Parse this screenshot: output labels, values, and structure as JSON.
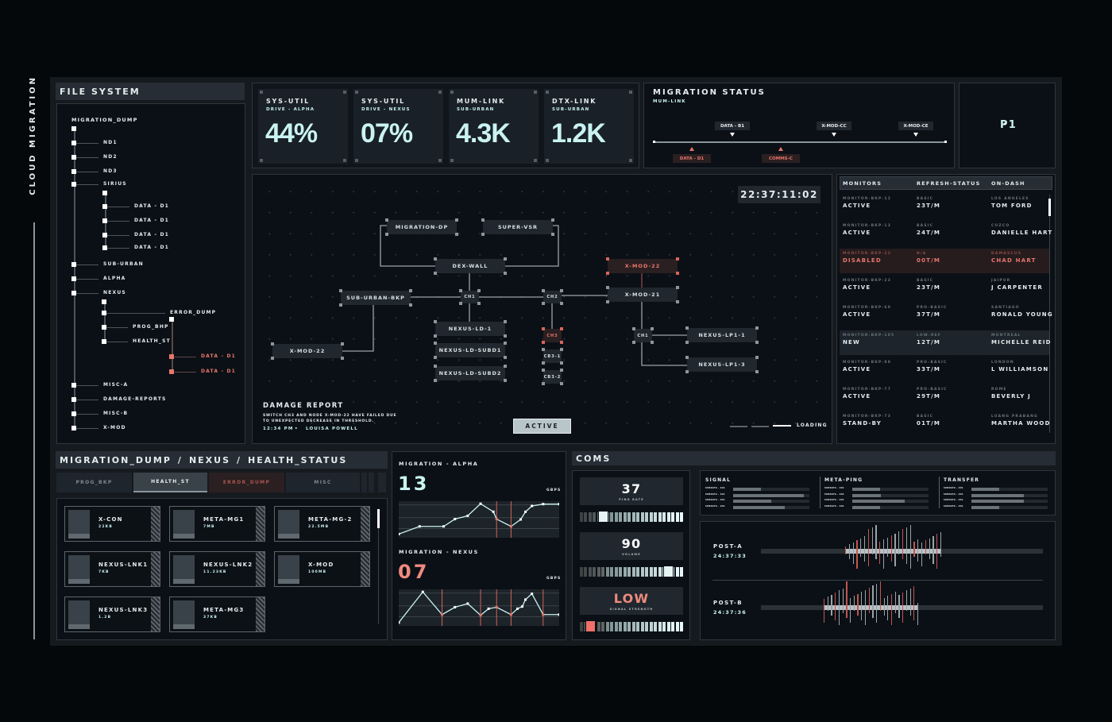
{
  "side_title": "CLOUD MIGRATION",
  "file_system": {
    "title": "FILE SYSTEM",
    "root": "MIGRATION_DUMP",
    "items": [
      {
        "label": "ND1"
      },
      {
        "label": "ND2"
      },
      {
        "label": "ND3"
      },
      {
        "label": "SIRIUS"
      },
      {
        "label": "DATA - D1"
      },
      {
        "label": "DATA - D1"
      },
      {
        "label": "DATA - D1"
      },
      {
        "label": "DATA - D1"
      },
      {
        "label": "SUB-URBAN"
      },
      {
        "label": "ALPHA"
      },
      {
        "label": "NEXUS"
      },
      {
        "label": "ERROR_DUMP"
      },
      {
        "label": "PROG_BHP"
      },
      {
        "label": "HEALTH_ST"
      },
      {
        "label": "DATA - D1",
        "state": "error"
      },
      {
        "label": "DATA - D1",
        "state": "error"
      },
      {
        "label": "MISC-A"
      },
      {
        "label": "DAMAGE-REPORTS"
      },
      {
        "label": "MISC-B"
      },
      {
        "label": "X-MOD"
      }
    ]
  },
  "stats": [
    {
      "title": "SYS-UTIL",
      "sub": "DRIVE - ALPHA",
      "value": "44%"
    },
    {
      "title": "SYS-UTIL",
      "sub": "DRIVE - NEXUS",
      "value": "07%"
    },
    {
      "title": "MUM-LINK",
      "sub": "SUB-URBAN",
      "value": "4.3K"
    },
    {
      "title": "DTX-LINK",
      "sub": "SUB-URBAN",
      "value": "1.2K"
    }
  ],
  "migration_status": {
    "title": "MIGRATION STATUS",
    "sub": "MUM-LINK",
    "above": [
      "DATA - B1",
      "X-MOD-CC",
      "X-MOD-CE"
    ],
    "below": [
      "DATA - D1",
      "COMMS-C"
    ]
  },
  "page_marker": "P1",
  "network": {
    "clock": "22:37:11:02",
    "nodes": [
      "MIGRATION-DP",
      "SUPER-VSR",
      "DEX-WALL",
      "X-MOD-22",
      "SUB-URBAN-BKP",
      "CH1",
      "CH2",
      "X-MOD-21",
      "NEXUS-LD-1",
      "NEXUS-LD-SUBD1",
      "NEXUS-LD-SUBD2",
      "CH3",
      "CB3-1",
      "CB3-2",
      "CH1",
      "NEXUS-LP1-1",
      "NEXUS-LP1-3",
      "X-MOD-22"
    ],
    "failed": [
      3,
      11
    ],
    "damage_title": "DAMAGE REPORT",
    "damage_text": "SWITCH CH3 AND NODE X-MOD-22 HAVE FAILED DUE TO UNEXPECTED DECREASE IN THRESHOLD.",
    "damage_time": "12:34 PM",
    "damage_author": "LOUISA POWELL",
    "status_button": "ACTIVE",
    "loading": "LOADING"
  },
  "monitors": {
    "headers": [
      "MONITORS",
      "REFRESH-STATUS",
      "ON-DASH"
    ],
    "rows": [
      {
        "id": "MONITOR-BKP-12",
        "status": "ACTIVE",
        "plan": "BASIC",
        "rate": "23T/M",
        "city": "LOS ANGELES",
        "name": "TOM FORD"
      },
      {
        "id": "MONITOR-BKP-13",
        "status": "ACTIVE",
        "plan": "BASIC",
        "rate": "24T/M",
        "city": "CUZCO",
        "name": "DANIELLE HART"
      },
      {
        "id": "MONITOR-BKP-22",
        "status": "DISABLED",
        "plan": "N/A",
        "rate": "00T/M",
        "city": "DAMASCUS",
        "name": "CHAD HART",
        "state": "error"
      },
      {
        "id": "MONITOR-BKP-23",
        "status": "ACTIVE",
        "plan": "BASIC",
        "rate": "23T/M",
        "city": "JAIPUR",
        "name": "J CARPENTER"
      },
      {
        "id": "MONITOR-BKP-60",
        "status": "ACTIVE",
        "plan": "PRO-BASIC",
        "rate": "37T/M",
        "city": "SANTIAGO",
        "name": "RONALD YOUNG"
      },
      {
        "id": "MONITOR-BKP-105",
        "status": "NEW",
        "plan": "LOW-REF",
        "rate": "12T/M",
        "city": "MONTREAL",
        "name": "MICHELLE REID",
        "state": "selected"
      },
      {
        "id": "MONITOR-BKP-88",
        "status": "ACTIVE",
        "plan": "PRO-BASIC",
        "rate": "33T/M",
        "city": "LONDON",
        "name": "L WILLIAMSON"
      },
      {
        "id": "MONITOR-BKP-77",
        "status": "ACTIVE",
        "plan": "PRO-BASIC",
        "rate": "29T/M",
        "city": "ROME",
        "name": "BEVERLY J"
      },
      {
        "id": "MONITOR-BKP-73",
        "status": "STAND-BY",
        "plan": "BASIC",
        "rate": "01T/M",
        "city": "LUANG PRABANG",
        "name": "MARTHA WOOD"
      }
    ]
  },
  "breadcrumb": [
    "MIGRATION_DUMP",
    "NEXUS",
    "HEALTH_STATUS"
  ],
  "tabs": [
    {
      "label": "PROG_BKP"
    },
    {
      "label": "HEALTH_ST",
      "active": true
    },
    {
      "label": "ERROR_DUMP",
      "state": "error"
    },
    {
      "label": "MISC"
    }
  ],
  "files": [
    {
      "name": "X-CON",
      "size": "22KB"
    },
    {
      "name": "META-MG1",
      "size": "7MB"
    },
    {
      "name": "META-MG-2",
      "size": "22.5MB"
    },
    {
      "name": "NEXUS-LNK1",
      "size": "7KB"
    },
    {
      "name": "NEXUS-LNK2",
      "size": "11.23KB"
    },
    {
      "name": "X-MOD",
      "size": "100MB"
    },
    {
      "name": "NEXUS-LNK3",
      "size": "1.2B"
    },
    {
      "name": "META-MG3",
      "size": "37KB"
    }
  ],
  "chart_data": [
    {
      "type": "line",
      "title": "MIGRATION - ALPHA",
      "value": "13",
      "unit": "GBPS",
      "x": [
        0,
        13,
        28,
        35,
        43,
        51,
        59,
        61,
        70,
        76,
        79,
        83,
        90,
        100
      ],
      "y": [
        10,
        31,
        31,
        51,
        60,
        93,
        71,
        51,
        31,
        50,
        71,
        87,
        92,
        92
      ],
      "alerts": [
        61,
        70
      ]
    },
    {
      "type": "line",
      "title": "MIGRATION - NEXUS",
      "value": "07",
      "unit": "GBPS",
      "x": [
        0,
        15,
        27,
        35,
        43,
        51,
        56,
        61,
        70,
        74,
        77,
        79,
        83,
        90,
        100
      ],
      "y": [
        9,
        93,
        31,
        51,
        61,
        29,
        47,
        51,
        31,
        47,
        53,
        72,
        88,
        31,
        31
      ],
      "alerts": [
        27,
        51,
        61,
        70,
        90
      ]
    }
  ],
  "coms": {
    "title": "COMS",
    "dials": [
      {
        "value": "37",
        "label": "PING RATE",
        "level": 0.22
      },
      {
        "value": "90",
        "label": "VOLUME",
        "level": 0.85
      },
      {
        "value": "LOW",
        "label": "SIGNAL STRENGTH",
        "level": 0.1,
        "state": "error"
      }
    ],
    "meters": [
      {
        "title": "SIGNAL",
        "rows": [
          {
            "label": "SUBDATA - 001",
            "level": 0.36
          },
          {
            "label": "SUBDATA - 001",
            "level": 0.93
          },
          {
            "label": "SUBDATA - 001",
            "level": 0.5
          },
          {
            "label": "SUBDATA - 001",
            "level": 0.68
          }
        ]
      },
      {
        "title": "META-PING",
        "rows": [
          {
            "label": "SUBDATA - 001",
            "level": 0.36
          },
          {
            "label": "SUBDATA - 001",
            "level": 0.37
          },
          {
            "label": "SUBDATA - 001",
            "level": 0.69
          },
          {
            "label": "SUBDATA - 001",
            "level": 0.36
          }
        ]
      },
      {
        "title": "TRANSFER",
        "rows": [
          {
            "label": "SUBDATA - 001",
            "level": 0.36
          },
          {
            "label": "SUBDATA - 001",
            "level": 0.69
          },
          {
            "label": "SUBDATA - 001",
            "level": 0.69
          },
          {
            "label": "SUBDATA - 001",
            "level": 0.36
          }
        ]
      }
    ],
    "posts": [
      {
        "name": "POST-A",
        "time": "24:37:33"
      },
      {
        "name": "POST-B",
        "time": "24:37:36"
      }
    ]
  },
  "colors": {
    "accent": "#c9f3f2",
    "error": "#e8766c",
    "panel": "#0b1016",
    "chip": "#20272e"
  }
}
